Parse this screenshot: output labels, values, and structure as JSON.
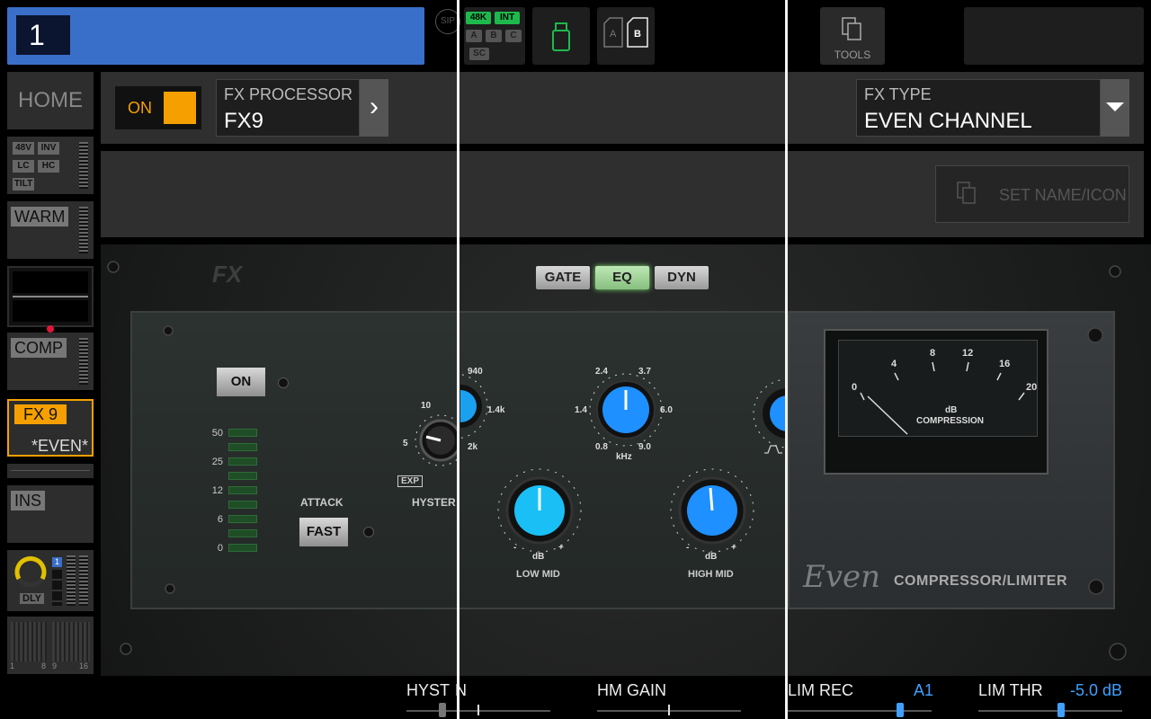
{
  "topbar": {
    "channel_number": "1",
    "sip_label": "SIP",
    "clock_tags": [
      "48K",
      "INT"
    ],
    "source_tags": [
      "A",
      "B",
      "C",
      "SC"
    ],
    "ab_left": "A",
    "ab_right": "B",
    "tools_label": "TOOLS"
  },
  "sidebar": {
    "home_label": "HOME",
    "preamp_tags": [
      "48V",
      "INV",
      "LC",
      "HC",
      "TILT"
    ],
    "warm_label": "WARM",
    "comp_label": "COMP",
    "fx_label": "FX 9",
    "fx_name": "*EVEN*",
    "ins_label": "INS",
    "dly_label": "DLY",
    "dly_badge": "1",
    "meter_left_label": "1",
    "meter_mid_label": "8",
    "meter_mid2_label": "9",
    "meter_right_label": "16"
  },
  "header": {
    "on_label": "ON",
    "fx_processor_label": "FX PROCESSOR",
    "fx_processor_value": "FX9",
    "fx_type_label": "FX TYPE",
    "fx_type_value": "EVEN CHANNEL",
    "set_name_label": "SET NAME/ICON"
  },
  "plugin": {
    "logo": "FX",
    "modes": [
      "GATE",
      "EQ",
      "DYN"
    ],
    "active_mode": "EQ",
    "on_button": "ON",
    "attack_label": "ATTACK",
    "attack_value": "FAST",
    "gr_scale": [
      "50",
      "25",
      "12",
      "6",
      "0"
    ],
    "hyst_scale": [
      "10",
      "5"
    ],
    "exp_label": "EXP",
    "hyst_label": "HYSTER",
    "lowmid_freq_scale": [
      "940",
      "1.4k",
      "2k"
    ],
    "highmid_freq_scale": [
      "2.4",
      "3.7",
      "1.4",
      "6.0",
      "0.8",
      "9.0"
    ],
    "khz_label": "kHz",
    "db_label": "dB",
    "minus": "-",
    "plus": "+",
    "low_mid_label": "LOW MID",
    "high_mid_label": "HIGH MID",
    "vu_scale": [
      "0",
      "4",
      "8",
      "12",
      "16",
      "20"
    ],
    "vu_unit": "dB",
    "vu_caption": "COMPRESSION",
    "brand": "Even",
    "brand_sub": "COMPRESSOR/LIMITER"
  },
  "params": [
    {
      "label": "HYST",
      "value": "",
      "fraction": 0.25
    },
    {
      "label": "N",
      "value": "",
      "fraction": 0.15
    },
    {
      "label": "HM GAIN",
      "value": "",
      "fraction": 0.5
    },
    {
      "label": "LIM REC",
      "value": "A1",
      "fraction": 0.8
    },
    {
      "label": "LIM THR",
      "value": "-5.0 dB",
      "fraction": 0.58
    }
  ],
  "colors": {
    "channel_blue": "#3a6fc9",
    "accent_orange": "#f5a000",
    "led_green": "#1eb94c",
    "value_blue": "#3fa0ff",
    "knob_blue": "#1e90ff"
  }
}
